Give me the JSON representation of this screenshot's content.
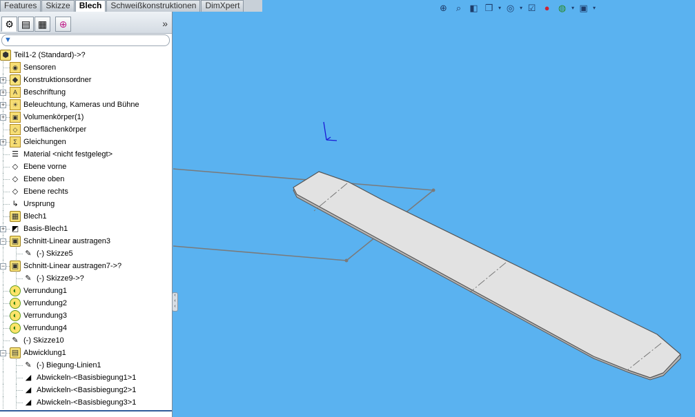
{
  "tabs": [
    "Features",
    "Skizze",
    "Blech",
    "Schweißkonstruktionen",
    "DimXpert"
  ],
  "active_tab": "Blech",
  "panel": {
    "toolbar_icons": [
      "feature-manager-icon",
      "property-manager-icon",
      "configuration-manager-icon",
      "dimxpert-manager-icon"
    ],
    "more_label": "»",
    "filter_placeholder": ""
  },
  "tree": [
    {
      "label": "Teil1-2  (Standard)->?",
      "icon": "part-icon",
      "level": 0,
      "expander": ""
    },
    {
      "label": "Sensoren",
      "icon": "sensor-folder-icon",
      "level": 1,
      "expander": ""
    },
    {
      "label": "Konstruktionsordner",
      "icon": "design-binder-icon",
      "level": 1,
      "expander": "+"
    },
    {
      "label": "Beschriftung",
      "icon": "annotation-icon",
      "level": 1,
      "expander": "+"
    },
    {
      "label": "Beleuchtung, Kameras und Bühne",
      "icon": "lights-icon",
      "level": 1,
      "expander": "+"
    },
    {
      "label": "Volumenkörper(1)",
      "icon": "solid-bodies-icon",
      "level": 1,
      "expander": "+"
    },
    {
      "label": "Oberflächenkörper",
      "icon": "surface-bodies-icon",
      "level": 1,
      "expander": ""
    },
    {
      "label": "Gleichungen",
      "icon": "equations-icon",
      "level": 1,
      "expander": "+"
    },
    {
      "label": "Material <nicht festgelegt>",
      "icon": "material-icon",
      "level": 1,
      "expander": ""
    },
    {
      "label": "Ebene vorne",
      "icon": "plane-icon",
      "level": 1,
      "expander": ""
    },
    {
      "label": "Ebene oben",
      "icon": "plane-icon",
      "level": 1,
      "expander": ""
    },
    {
      "label": "Ebene rechts",
      "icon": "plane-icon",
      "level": 1,
      "expander": ""
    },
    {
      "label": "Ursprung",
      "icon": "origin-icon",
      "level": 1,
      "expander": ""
    },
    {
      "label": "Blech1",
      "icon": "sheet-metal-icon",
      "level": 1,
      "expander": ""
    },
    {
      "label": "Basis-Blech1",
      "icon": "base-flange-icon",
      "level": 1,
      "expander": "+"
    },
    {
      "label": "Schnitt-Linear austragen3",
      "icon": "cut-extrude-icon",
      "level": 1,
      "expander": "−"
    },
    {
      "label": "(-) Skizze5",
      "icon": "sketch-icon",
      "level": 2,
      "expander": ""
    },
    {
      "label": "Schnitt-Linear austragen7->?",
      "icon": "cut-extrude-icon",
      "level": 1,
      "expander": "−"
    },
    {
      "label": "(-) Skizze9->?",
      "icon": "sketch-icon",
      "level": 2,
      "expander": ""
    },
    {
      "label": "Verrundung1",
      "icon": "fillet-icon",
      "level": 1,
      "expander": ""
    },
    {
      "label": "Verrundung2",
      "icon": "fillet-icon",
      "level": 1,
      "expander": ""
    },
    {
      "label": "Verrundung3",
      "icon": "fillet-icon",
      "level": 1,
      "expander": ""
    },
    {
      "label": "Verrundung4",
      "icon": "fillet-icon",
      "level": 1,
      "expander": ""
    },
    {
      "label": "(-) Skizze10",
      "icon": "sketch-icon",
      "level": 1,
      "expander": ""
    },
    {
      "label": "Abwicklung1",
      "icon": "flat-pattern-icon",
      "level": 1,
      "expander": "−"
    },
    {
      "label": "(-) Biegung-Linien1",
      "icon": "bend-lines-icon",
      "level": 2,
      "expander": ""
    },
    {
      "label": "Abwickeln-<Basisbiegung1>1",
      "icon": "unfold-icon",
      "level": 2,
      "expander": ""
    },
    {
      "label": "Abwickeln-<Basisbiegung2>1",
      "icon": "unfold-icon",
      "level": 2,
      "expander": ""
    },
    {
      "label": "Abwickeln-<Basisbiegung3>1",
      "icon": "unfold-icon",
      "level": 2,
      "expander": ""
    }
  ],
  "view_toolbar": [
    "zoom-to-fit-icon",
    "zoom-area-icon",
    "section-view-icon",
    "view-orientation-icon",
    "display-style-icon",
    "hide-show-items-icon",
    "edit-appearance-icon",
    "apply-scene-icon",
    "view-settings-icon"
  ],
  "colors": {
    "viewport_background": "#5ab2f0",
    "part_face": "#e2e2e2",
    "edge": "#555555",
    "sketch_line": "#7a7a7a",
    "triad_blue": "#1a1ad6"
  }
}
